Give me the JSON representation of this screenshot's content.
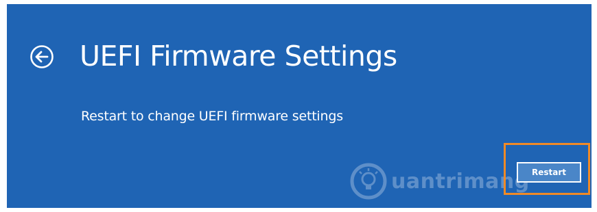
{
  "window": {
    "background_color": "#1f64b4",
    "accent_highlight_color": "#f08a26"
  },
  "header": {
    "back_icon": "circle-back-arrow-icon",
    "title": "UEFI Firmware Settings"
  },
  "main": {
    "description": "Restart to change UEFI firmware settings",
    "restart_label": "Restart"
  },
  "watermark": {
    "icon": "lightbulb-icon",
    "text": "uantrimang"
  }
}
